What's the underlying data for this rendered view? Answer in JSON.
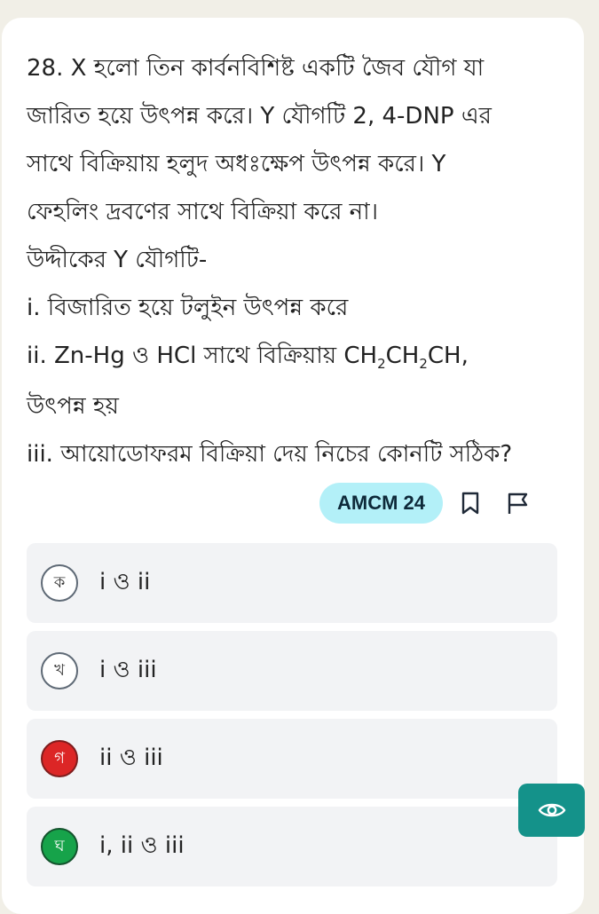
{
  "question": {
    "lines": [
      "28. X হলো তিন কার্বনবিশিষ্ট একটি জৈব যৌগ যা",
      "জারিত হয়ে উৎপন্ন করে। Y যৌগটি 2, 4-DNP এর",
      "সাথে বিক্রিয়ায় হলুদ অধঃক্ষেপ উৎপন্ন করে। Y",
      "ফেহলিং দ্রবণের সাথে বিক্রিয়া করে না।",
      "উদ্দীকের Y যৌগটি-",
      "i. বিজারিত হয়ে টলুইন উৎপন্ন করে"
    ],
    "stmt2_prefix": "ii. Zn-Hg ও HCl সাথে বিক্রিয়ায় ",
    "formula_a": "CH",
    "sub_a": "2",
    "formula_b": "CH",
    "sub_b": "2",
    "formula_c": "CH,",
    "lines_after": [
      "উৎপন্ন হয়",
      "iii. আয়োডোফরম বিক্রিয়া দেয় নিচের কোনটি সঠিক?"
    ]
  },
  "tag": {
    "label": "AMCM 24"
  },
  "options": [
    {
      "letter": "ক",
      "text": "i ও ii",
      "state": "default"
    },
    {
      "letter": "খ",
      "text": "i ও iii",
      "state": "default"
    },
    {
      "letter": "গ",
      "text": "ii ও iii",
      "state": "wrong"
    },
    {
      "letter": "ঘ",
      "text": "i, ii ও iii",
      "state": "correct"
    }
  ],
  "colors": {
    "tag_bg": "#b3f0f8",
    "wrong": "#dc2626",
    "correct": "#16a34a",
    "eye_button": "#14928a"
  },
  "icons": [
    "bookmark-icon",
    "flag-icon",
    "eye-icon"
  ]
}
